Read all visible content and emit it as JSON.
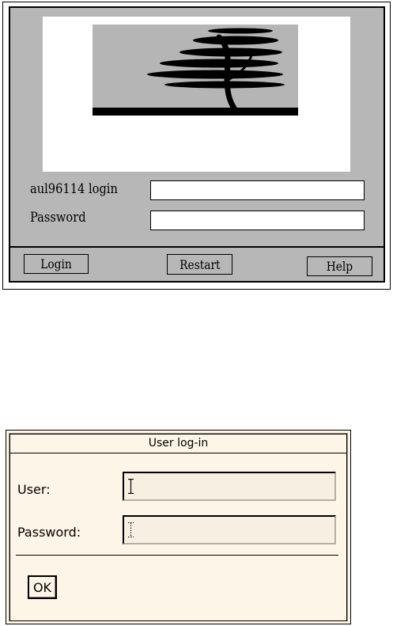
{
  "xdm_login": {
    "logo": "tree-logo",
    "login_label": "aul96114 login",
    "login_value": "",
    "password_label": "Password",
    "password_value": "",
    "buttons": {
      "login": "Login",
      "restart": "Restart",
      "help": "Help"
    },
    "colors": {
      "panel": "#b7b7b7",
      "logo_panel": "#ffffff",
      "text": "#000000"
    }
  },
  "tk_login": {
    "title": "User log-in",
    "user_label": "User:",
    "user_value": "",
    "password_label": "Password:",
    "password_value": "",
    "ok_label": "OK",
    "colors": {
      "background": "#fdf5e7",
      "text": "#000000"
    }
  }
}
